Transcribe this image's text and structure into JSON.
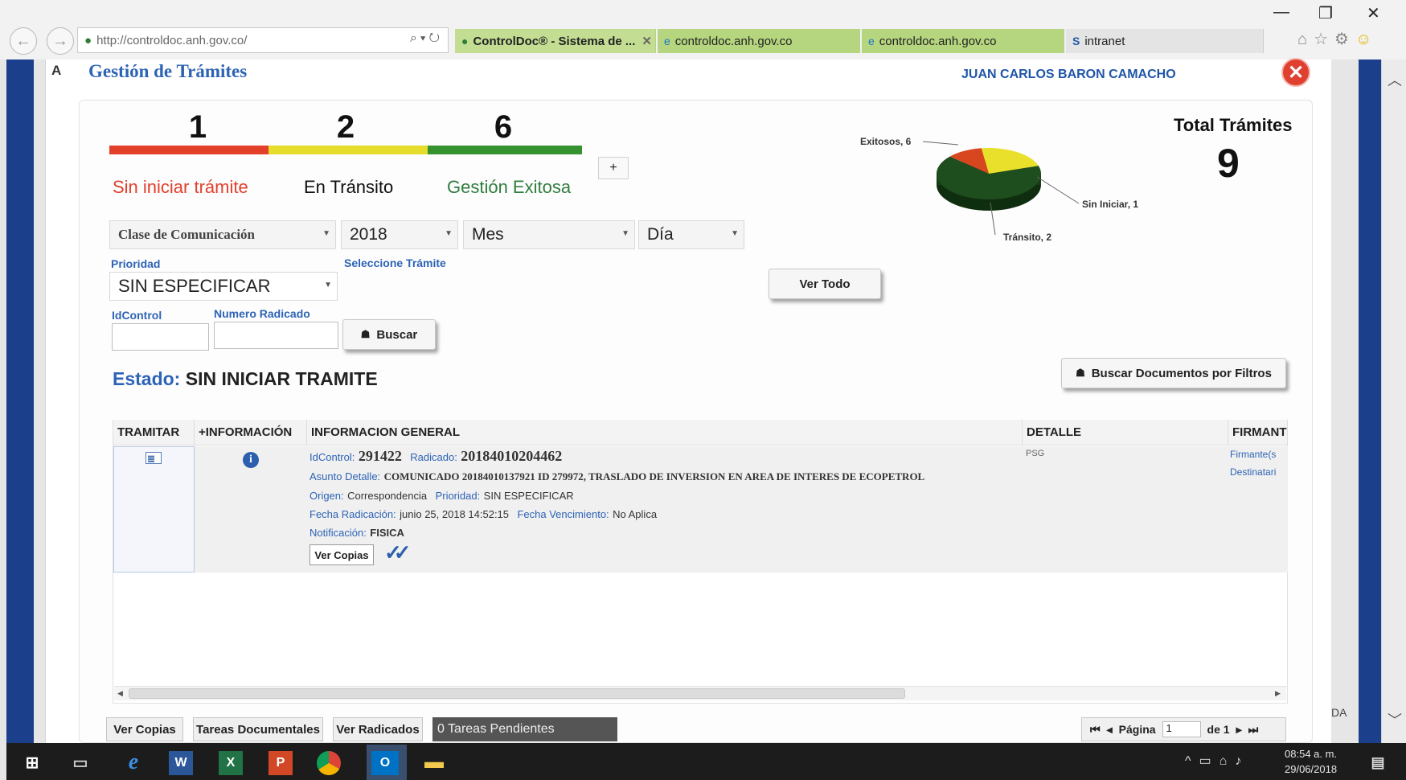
{
  "browser": {
    "address_url": "http://controldoc.anh.gov.co/",
    "tabs": [
      {
        "label": "ControlDoc® - Sistema de ...",
        "close": "✕"
      },
      {
        "label": "controldoc.anh.gov.co"
      },
      {
        "label": "controldoc.anh.gov.co"
      },
      {
        "label": "intranet"
      }
    ],
    "window_controls": [
      "—",
      "❐",
      "✕"
    ]
  },
  "sidebar_letter": "A",
  "header": {
    "title": "Gestión de Trámites",
    "user": "JUAN CARLOS BARON CAMACHO"
  },
  "summary": {
    "counts": [
      "1",
      "2",
      "6"
    ],
    "labels": [
      "Sin iniciar trámite",
      "En Tránsito",
      "Gestión Exitosa"
    ],
    "bar_colors": [
      "#e2402b",
      "#e5dc2b",
      "#36922f"
    ],
    "label_colors": [
      "#e2402b",
      "#111111",
      "#2f7d3e"
    ],
    "total_label": "Total Trámites",
    "total_value": "9",
    "expand": "+"
  },
  "pie": {
    "labels": [
      "Exitosos, 6",
      "Sin Iniciar, 1",
      "Tránsito, 2"
    ],
    "values": [
      6,
      1,
      2
    ],
    "colors": [
      "#1e4d1e",
      "#d8461f",
      "#e8e02a"
    ]
  },
  "filters": {
    "clase": "Clase de Comunicación",
    "year": "2018",
    "mes": "Mes",
    "dia": "Día",
    "prioridad_label": "Prioridad",
    "prioridad_value": "SIN ESPECIFICAR",
    "seleccione_tramite": "Seleccione Trámite",
    "idcontrol_label": "IdControl",
    "numero_radicado_label": "Numero Radicado",
    "buscar": "Buscar",
    "ver_todo": "Ver Todo",
    "buscar_filtros": "Buscar Documentos por Filtros"
  },
  "estado": {
    "key": "Estado:",
    "value": "SIN INICIAR TRAMITE"
  },
  "table": {
    "headers": [
      "TRAMITAR",
      "+INFORMACIÓN",
      "INFORMACION GENERAL",
      "DETALLE",
      "FIRMANTE"
    ],
    "row": {
      "idcontrol_label": "IdControl:",
      "idcontrol": "291422",
      "radicado_label": "Radicado:",
      "radicado": "20184010204462",
      "asunto_label": "Asunto Detalle:",
      "asunto": "COMUNICADO 20184010137921 ID 279972, TRASLADO DE INVERSION EN AREA DE INTERES DE ECOPETROL",
      "origen_label": "Origen:",
      "origen": "Correspondencia",
      "prioridad_label": "Prioridad:",
      "prioridad": "SIN ESPECIFICAR",
      "fecha_label": "Fecha Radicación:",
      "fecha": "junio 25, 2018 14:52:15",
      "vencimiento_label": "Fecha Vencimiento:",
      "vencimiento": "No Aplica",
      "notificacion_label": "Notificación:",
      "notificacion": "FISICA",
      "ver_copias": "Ver Copias",
      "detalle": "PSG",
      "firmante": "Firmante(s",
      "destinatario": "Destinatari"
    }
  },
  "bottom_tabs": [
    "Ver Copias",
    "Tareas Documentales",
    "Ver Radicados"
  ],
  "pending": "0 Tareas Pendientes",
  "pager": {
    "pagina_label": "Página",
    "page": "1",
    "de": "de 1"
  },
  "side_right_letters": "DA",
  "taskbar": {
    "time": "08:54 a. m.",
    "date": "29/06/2018"
  }
}
